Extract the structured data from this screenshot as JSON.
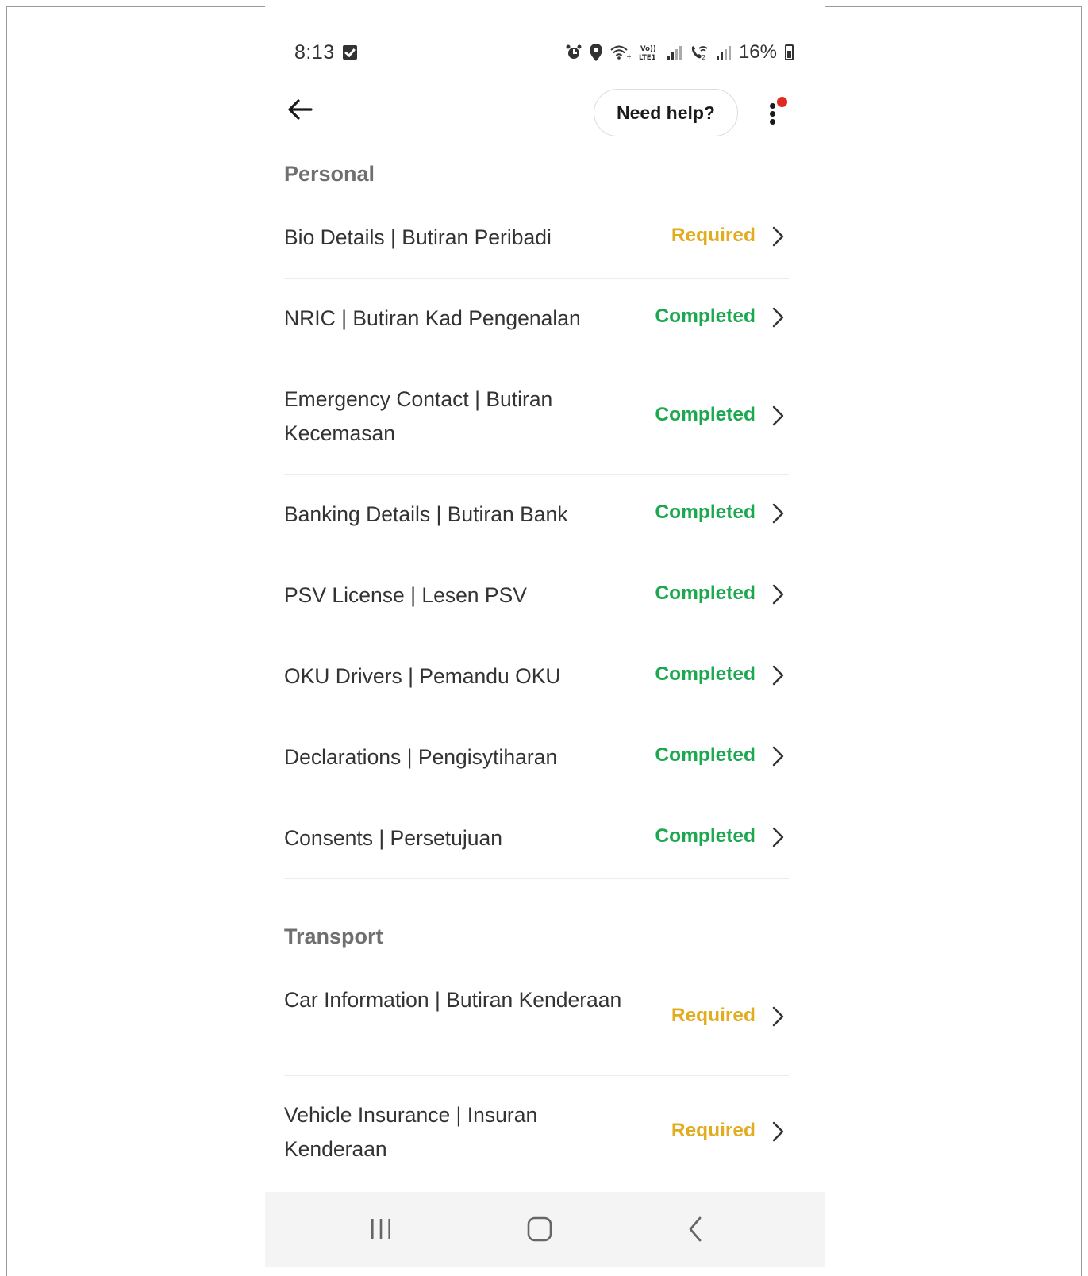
{
  "status_bar": {
    "time": "8:13",
    "battery": "16%",
    "icons": [
      "check-box-icon",
      "alarm-icon",
      "location-icon",
      "wifi-icon",
      "volte-icon",
      "signal-icon",
      "wifi-calling-icon",
      "signal-icon",
      "battery-icon"
    ]
  },
  "header": {
    "help_label": "Need help?",
    "back_icon": "back-arrow-icon",
    "menu_icon": "more-vertical-icon"
  },
  "colors": {
    "required": "#e2ac1f",
    "completed": "#1ba84f",
    "notification_dot": "#e02a1f"
  },
  "sections": [
    {
      "title": "Personal",
      "items": [
        {
          "label": "Bio Details | Butiran Peribadi",
          "status": "Required"
        },
        {
          "label": "NRIC | Butiran Kad Pengenalan",
          "status": "Completed"
        },
        {
          "label": "Emergency Contact | Butiran Kecemasan",
          "status": "Completed"
        },
        {
          "label": "Banking Details | Butiran Bank",
          "status": "Completed"
        },
        {
          "label": "PSV License | Lesen PSV",
          "status": "Completed"
        },
        {
          "label": "OKU Drivers | Pemandu OKU",
          "status": "Completed"
        },
        {
          "label": "Declarations | Pengisytiharan",
          "status": "Completed"
        },
        {
          "label": "Consents | Persetujuan",
          "status": "Completed"
        }
      ]
    },
    {
      "title": "Transport",
      "items": [
        {
          "label": "Car Information | Butiran Kenderaan",
          "status": "Required"
        },
        {
          "label": "Vehicle Insurance | Insuran Kenderaan",
          "status": "Required"
        }
      ]
    }
  ],
  "nav_bar": {
    "buttons": [
      "recent-apps-icon",
      "home-icon",
      "back-icon"
    ]
  }
}
